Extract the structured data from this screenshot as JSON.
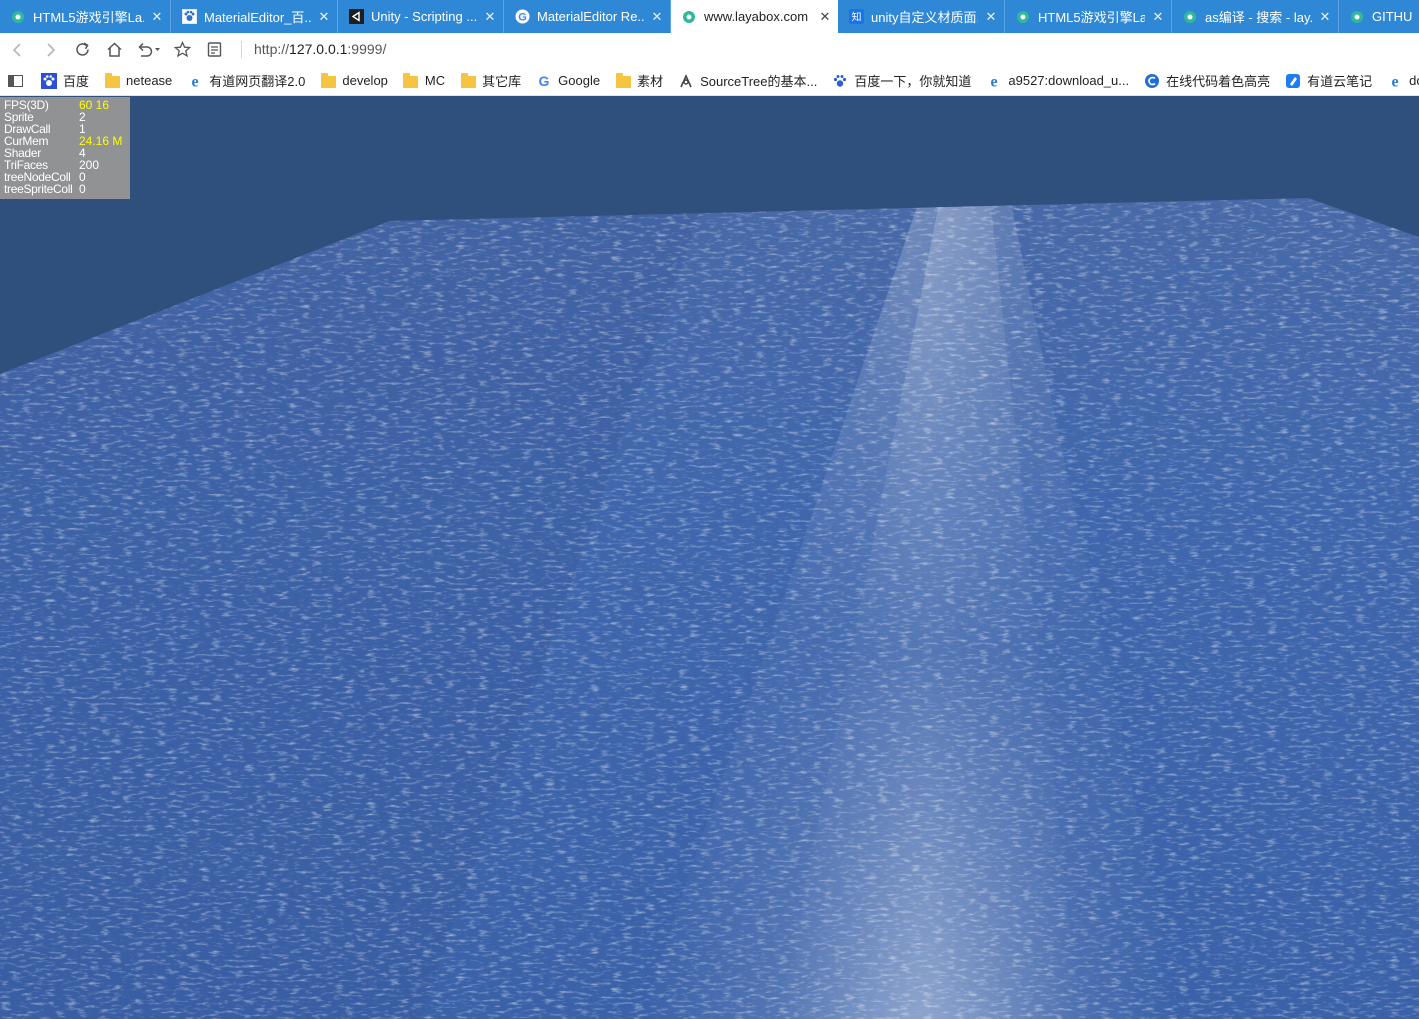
{
  "tabs": [
    {
      "title": "HTML5游戏引擎La...",
      "icon": "layabox-icon",
      "active": false
    },
    {
      "title": "MaterialEditor_百...",
      "icon": "baidu-icon",
      "active": false
    },
    {
      "title": "Unity - Scripting ...",
      "icon": "unity-icon",
      "active": false
    },
    {
      "title": "MaterialEditor Re...",
      "icon": "google-icon",
      "active": false
    },
    {
      "title": "www.layabox.com",
      "icon": "layabox-icon",
      "active": true
    },
    {
      "title": "unity自定义材质面...",
      "icon": "zhihu-icon",
      "active": false
    },
    {
      "title": "HTML5游戏引擎La...",
      "icon": "layabox-icon",
      "active": false
    },
    {
      "title": "as编译 - 搜索 - lay...",
      "icon": "layabox-icon",
      "active": false
    },
    {
      "title": "GITHUB",
      "icon": "layabox-icon",
      "active": false
    }
  ],
  "address": {
    "url_prefix": "http://",
    "url_host": "127.0.0.1",
    "url_suffix": ":9999/"
  },
  "bookmarks": [
    {
      "label": "百度",
      "icon": "baidu-icon"
    },
    {
      "label": "netease",
      "icon": "folder-icon"
    },
    {
      "label": "有道网页翻译2.0",
      "icon": "ie-icon"
    },
    {
      "label": "develop",
      "icon": "folder-icon"
    },
    {
      "label": "MC",
      "icon": "folder-icon"
    },
    {
      "label": "其它库",
      "icon": "folder-icon"
    },
    {
      "label": "Google",
      "icon": "google-icon"
    },
    {
      "label": "素材",
      "icon": "folder-icon"
    },
    {
      "label": "SourceTree的基本...",
      "icon": "sourcetree-icon"
    },
    {
      "label": "百度一下，你就知道",
      "icon": "baidu-paw-icon"
    },
    {
      "label": "a9527:download_u...",
      "icon": "ie-icon"
    },
    {
      "label": "在线代码着色高亮",
      "icon": "c-icon"
    },
    {
      "label": "有道云笔记",
      "icon": "youdao-note-icon"
    },
    {
      "label": "docs.gl",
      "icon": "ie-icon"
    }
  ],
  "stats": [
    {
      "label": "FPS(3D)",
      "value": "60 16",
      "highlight": true
    },
    {
      "label": "Sprite",
      "value": "2",
      "highlight": false
    },
    {
      "label": "DrawCall",
      "value": "1",
      "highlight": false
    },
    {
      "label": "CurMem",
      "value": "24.16 M",
      "highlight": true
    },
    {
      "label": "Shader",
      "value": "4",
      "highlight": false
    },
    {
      "label": "TriFaces",
      "value": "200",
      "highlight": false
    },
    {
      "label": "treeNodeColl",
      "value": "0",
      "highlight": false
    },
    {
      "label": "treeSpriteColl",
      "value": "0",
      "highlight": false
    }
  ],
  "colors": {
    "tab_bar": "#2f88d6",
    "sky": "#2f4f7d",
    "water": "#3f65a8",
    "highlight": "#ffff00"
  }
}
